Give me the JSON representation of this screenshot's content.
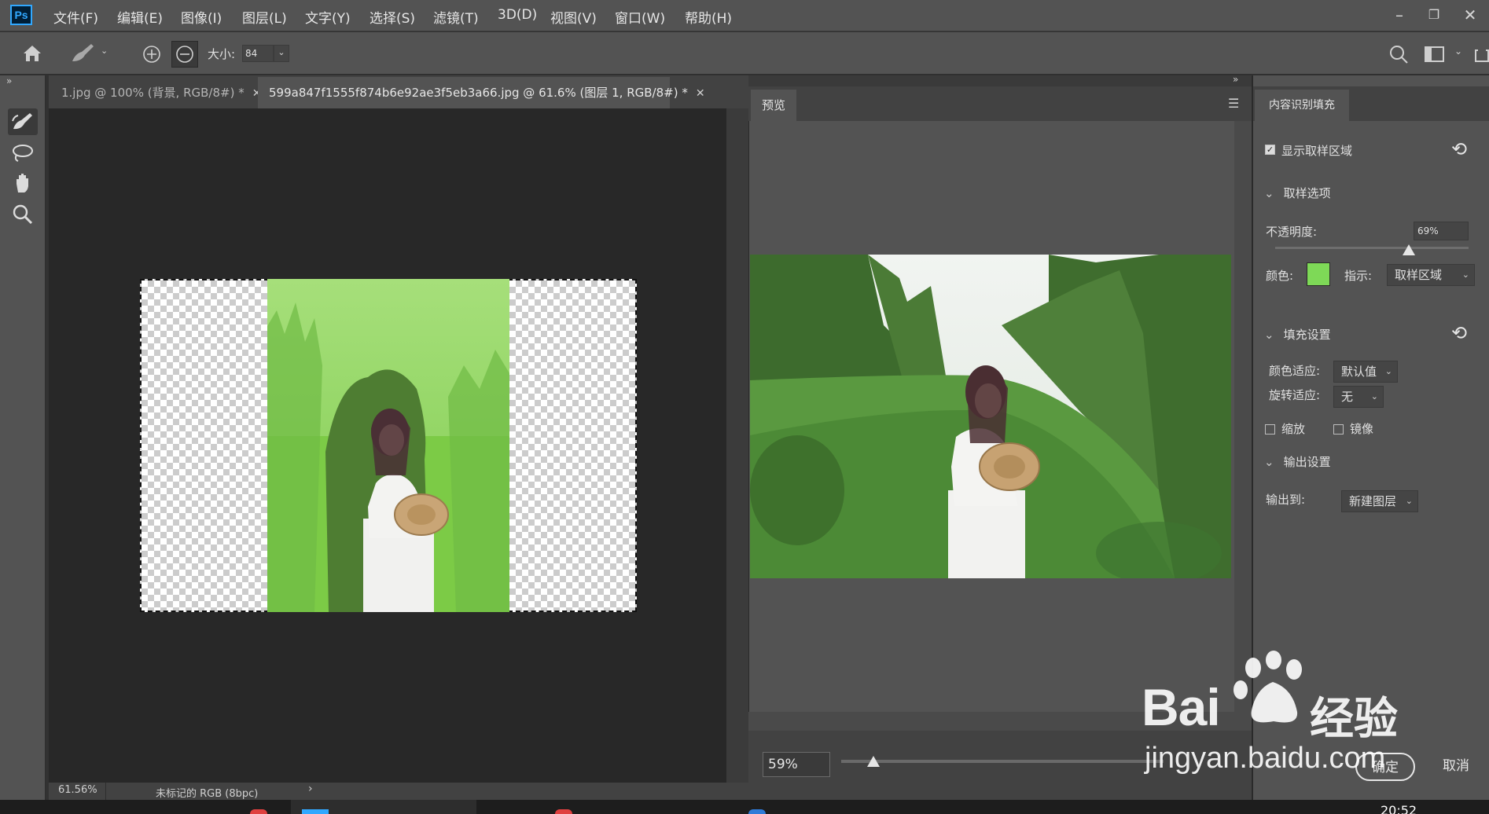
{
  "app": {
    "logo_text": "Ps"
  },
  "menu": [
    "文件(F)",
    "编辑(E)",
    "图像(I)",
    "图层(L)",
    "文字(Y)",
    "选择(S)",
    "滤镜(T)",
    "3D(D)",
    "视图(V)",
    "窗口(W)",
    "帮助(H)"
  ],
  "options_bar": {
    "size_label": "大小:",
    "size_value": "84"
  },
  "tabs": [
    {
      "label": "1.jpg @ 100% (背景, RGB/8#) *",
      "active": false
    },
    {
      "label": "599a847f1555f874b6e92ae3f5eb3a66.jpg  @ 61.6% (图层 1, RGB/8#) *",
      "active": true
    }
  ],
  "status_bar": {
    "zoom": "61.56%",
    "profile": "未标记的 RGB (8bpc)"
  },
  "preview": {
    "tab_label": "预览",
    "zoom_value": "59%",
    "zoom_level": 0.1
  },
  "content_aware_fill": {
    "tab_label": "内容识别填充",
    "show_sampling_area": {
      "label": "显示取样区域",
      "checked": true
    },
    "sampling_options": {
      "title": "取样选项",
      "opacity_label": "不透明度:",
      "opacity_value": "69%",
      "opacity_level": 0.69,
      "color_label": "颜色:",
      "color_hex": "#7ed957",
      "indicate_label": "指示:",
      "indicate_value": "取样区域"
    },
    "fill_settings": {
      "title": "填充设置",
      "color_adapt_label": "颜色适应:",
      "color_adapt_value": "默认值",
      "rotation_adapt_label": "旋转适应:",
      "rotation_adapt_value": "无",
      "scale_label": "缩放",
      "mirror_label": "镜像"
    },
    "output_settings": {
      "title": "输出设置",
      "output_label": "输出到:",
      "output_value": "新建图层"
    },
    "ok_label": "确定",
    "cancel_label": "取消"
  },
  "watermark": {
    "brand": "Bai",
    "brand_cn": "经验",
    "url": "jingyan.baidu.com"
  },
  "taskbar": {
    "clock": "20:52"
  },
  "colors": {
    "sampling_green": "#86cf5e",
    "panel_bg": "#535353",
    "canvas_bg": "#282828"
  }
}
